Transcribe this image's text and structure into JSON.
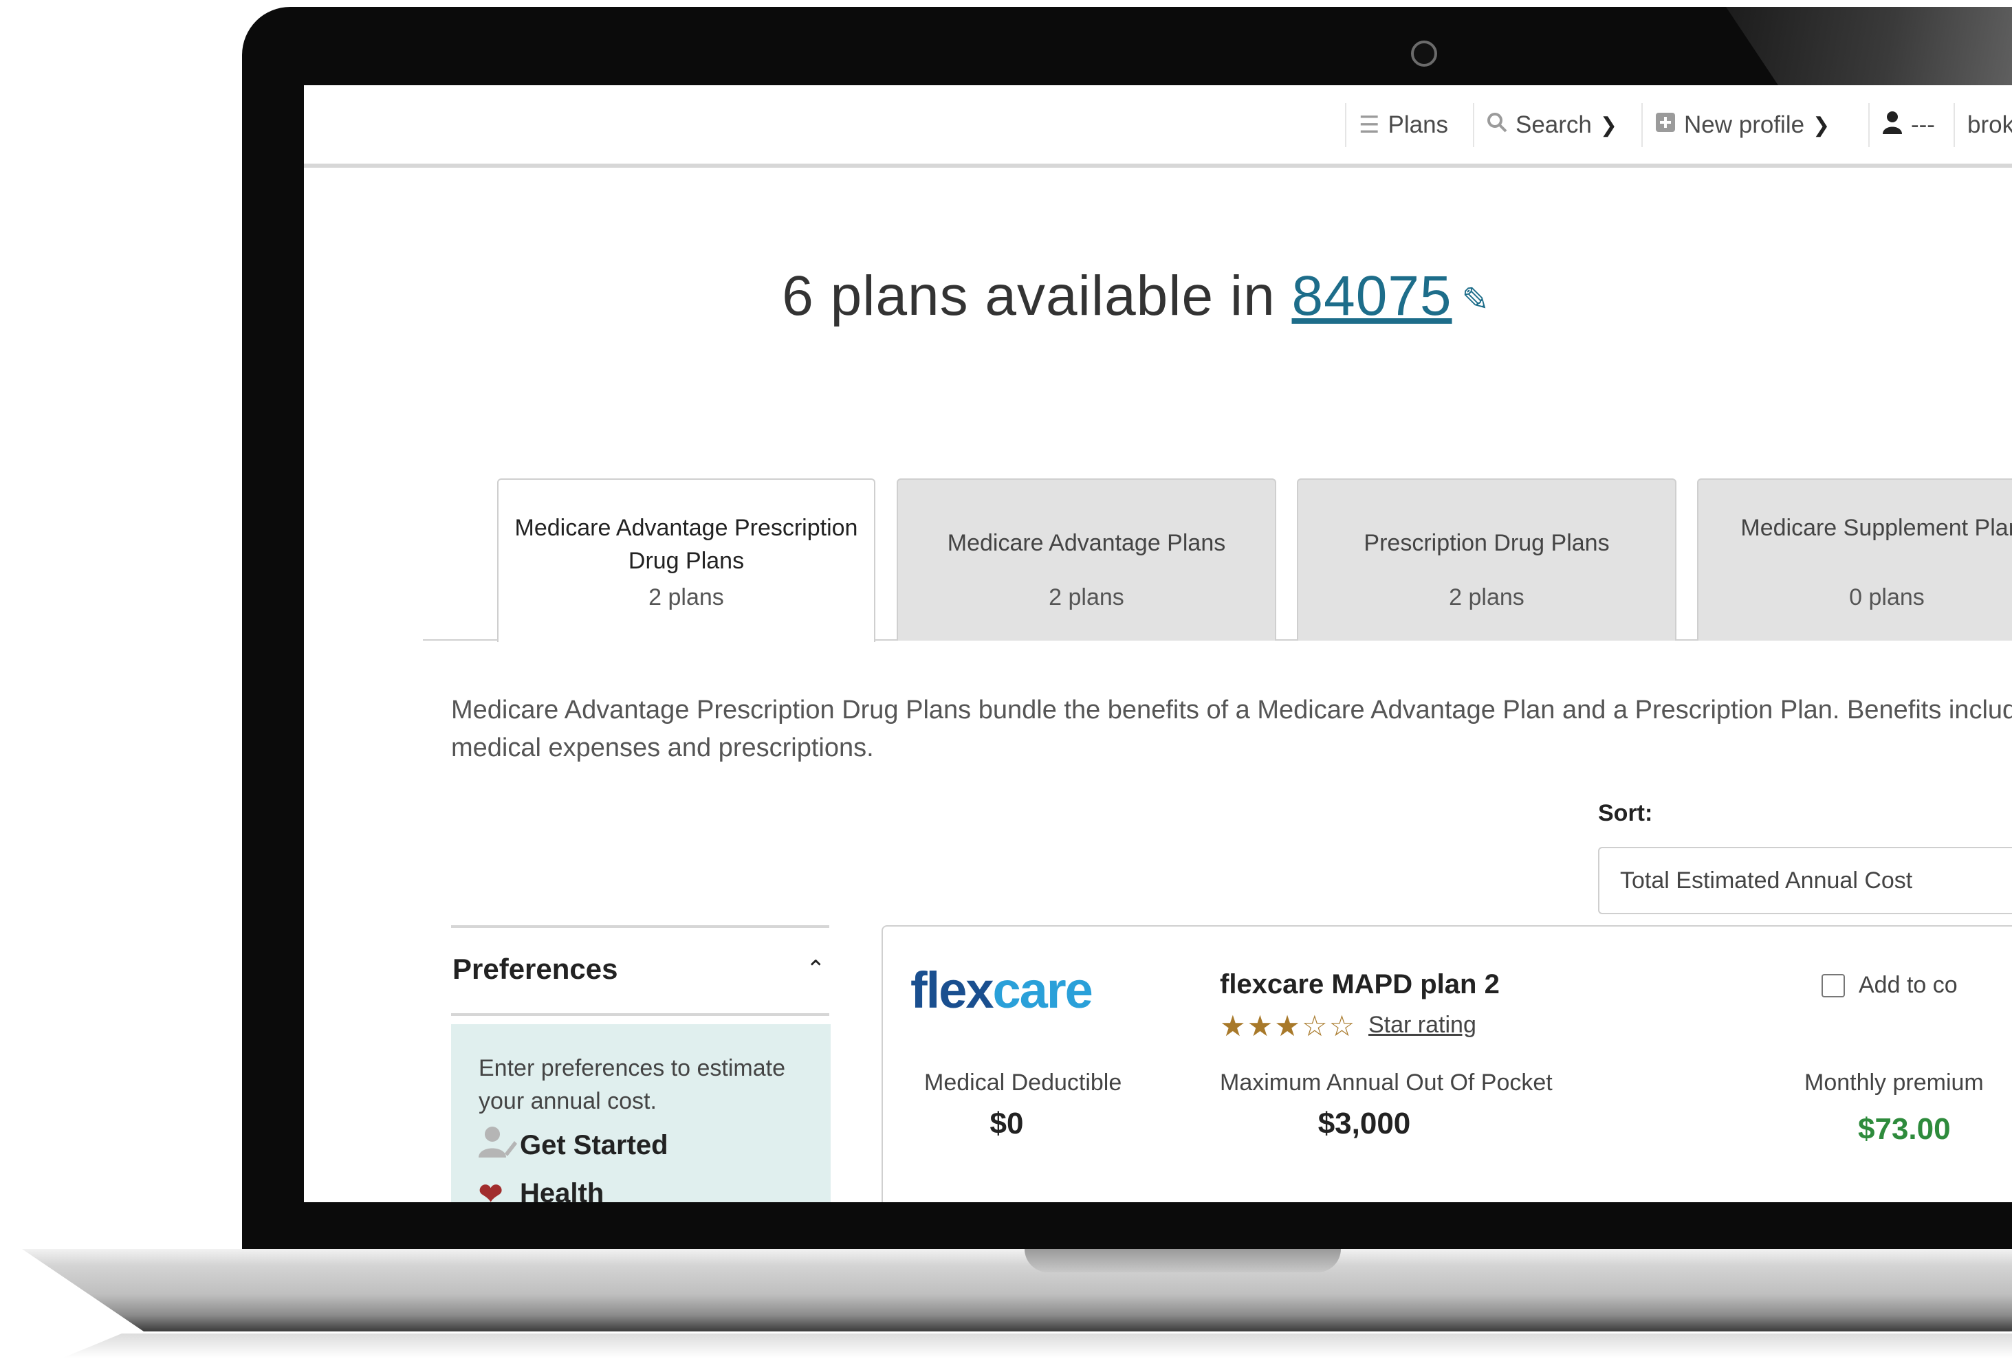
{
  "nav": {
    "plans": "Plans",
    "search": "Search",
    "new_profile": "New profile",
    "user": "---",
    "broker": "brok"
  },
  "headline": {
    "prefix": "6 plans available in",
    "zip": "84075"
  },
  "tabs": [
    {
      "name": "Medicare Advantage Prescription Drug Plans",
      "count": "2 plans",
      "active": true
    },
    {
      "name": "Medicare Advantage Plans",
      "count": "2 plans",
      "active": false
    },
    {
      "name": "Prescription Drug Plans",
      "count": "2 plans",
      "active": false
    },
    {
      "name": "Medicare Supplement Plans",
      "count": "0 plans",
      "active": false
    }
  ],
  "description": "Medicare Advantage Prescription Drug Plans bundle the benefits of a Medicare Advantage Plan and a Prescription Plan. Benefits include medical expenses and prescriptions.",
  "sort": {
    "label": "Sort:",
    "selected": "Total Estimated Annual Cost"
  },
  "preferences": {
    "title": "Preferences",
    "text": "Enter preferences to estimate your annual cost.",
    "items": [
      {
        "label": "Get Started",
        "icon": "user-edit-icon"
      },
      {
        "label": "Health",
        "icon": "heartbeat-icon"
      }
    ]
  },
  "plan": {
    "logo_part1": "flex",
    "logo_part2": "care",
    "name": "flexcare MAPD plan 2",
    "rating_stars": 3,
    "rating_max": 5,
    "rating_link": "Star rating",
    "compare": "Add to co",
    "stats": [
      {
        "label": "Medical Deductible",
        "value": "$0"
      },
      {
        "label": "Maximum Annual Out Of Pocket",
        "value": "$3,000"
      },
      {
        "label": "Monthly premium",
        "value": "$73.00"
      }
    ]
  },
  "colors": {
    "link": "#1d6d8a",
    "price_green": "#2e8b3c",
    "star_gold": "#a8792a",
    "pref_bg": "#e0efee",
    "primary_button": "#f0a91c"
  }
}
